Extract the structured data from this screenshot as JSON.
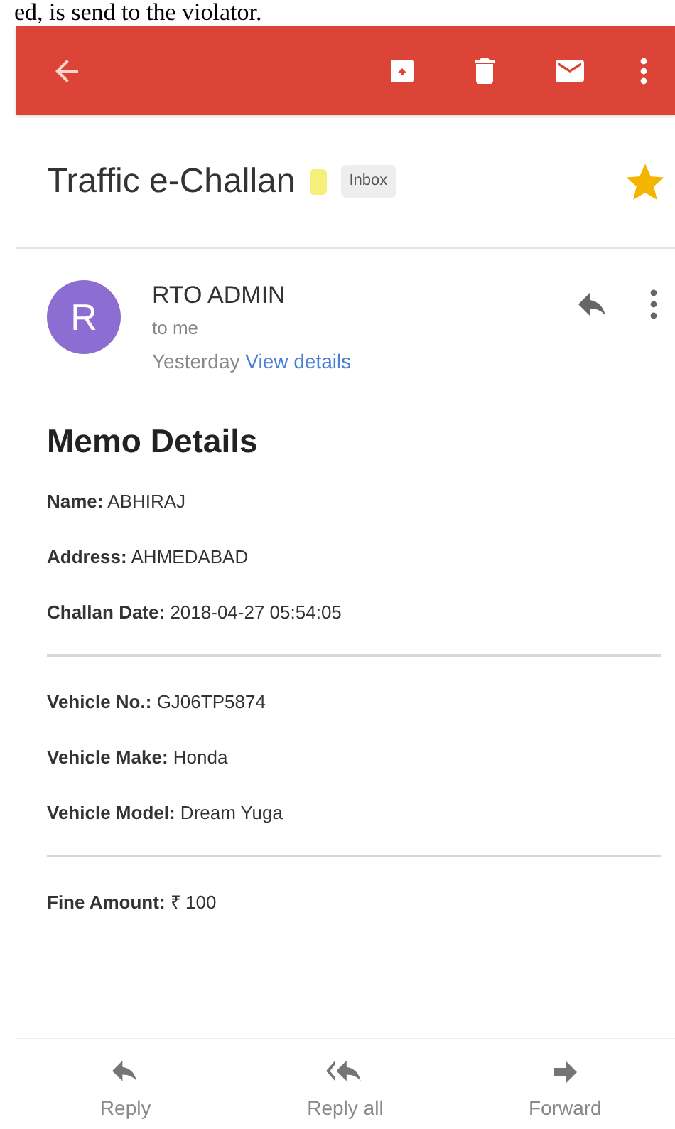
{
  "caption_fragment": "ed, is send to the violator.",
  "toolbar": {
    "actions": [
      {
        "kind": "back"
      },
      {
        "kind": "archive"
      },
      {
        "kind": "delete"
      },
      {
        "kind": "mark-unread"
      },
      {
        "kind": "more"
      }
    ]
  },
  "subject": {
    "title": "Traffic e-Challan",
    "important": true,
    "label": "Inbox",
    "starred": true
  },
  "message": {
    "avatar_letter": "R",
    "sender": "RTO ADMIN",
    "recipient": "to me",
    "date": "Yesterday",
    "details_link": "View details"
  },
  "memo": {
    "heading": "Memo Details",
    "groups": [
      [
        "**Name:** ABHIRAJ",
        "**Address:** AHMEDABAD",
        "**Challan Date:** 2018-04-27 05:54:05"
      ],
      [
        "**Vehicle No.:** GJ06TP5874",
        "**Vehicle Make:** Honda",
        "**Vehicle Model:** Dream Yuga"
      ],
      [
        "**Fine Amount:** ₹ 100"
      ]
    ]
  },
  "bottom_actions": [
    {
      "kind": "reply",
      "label": "Reply"
    },
    {
      "kind": "reply_all",
      "label": "Reply all"
    },
    {
      "kind": "forward",
      "label": "Forward"
    }
  ]
}
